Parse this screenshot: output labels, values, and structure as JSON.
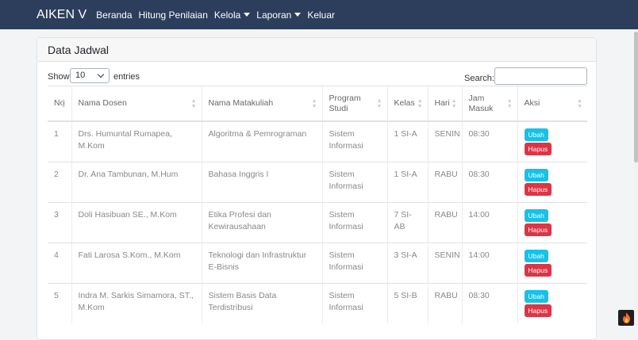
{
  "navbar": {
    "brand": "AIKEN V",
    "items": [
      {
        "label": "Beranda"
      },
      {
        "label": "Hitung Penilaian"
      },
      {
        "label": "Kelola"
      },
      {
        "label": "Laporan"
      },
      {
        "label": "Keluar"
      }
    ]
  },
  "card": {
    "title": "Data Jadwal"
  },
  "table_controls": {
    "show_label": "Show",
    "entries_value": "10",
    "entries_label": "entries",
    "search_label": "Search:",
    "search_value": ""
  },
  "table": {
    "headers": [
      "No",
      "Nama Dosen",
      "Nama Matakuliah",
      "Program Studi",
      "Kelas",
      "Hari",
      "Jam Masuk",
      "Aksi"
    ],
    "rows": [
      {
        "no": "1",
        "dosen": "Drs. Humuntal Rumapea, M.Kom",
        "matakuliah": "Algoritma & Pemrograman",
        "prodi": "Sistem Informasi",
        "kelas": "1 SI-A",
        "hari": "SENIN",
        "jam": "08:30"
      },
      {
        "no": "2",
        "dosen": "Dr. Ana Tambunan, M.Hum",
        "matakuliah": "Bahasa Inggris I",
        "prodi": "Sistem Informasi",
        "kelas": "1 SI-A",
        "hari": "RABU",
        "jam": "08:30"
      },
      {
        "no": "3",
        "dosen": "Doli Hasibuan SE., M.Kom",
        "matakuliah": "Etika Profesi dan Kewirausahaan",
        "prodi": "Sistem Informasi",
        "kelas": "7 SI-AB",
        "hari": "RABU",
        "jam": "14:00"
      },
      {
        "no": "4",
        "dosen": "Fati Larosa S.Kom., M.Kom",
        "matakuliah": "Teknologi dan Infrastruktur E-Bisnis",
        "prodi": "Sistem Informasi",
        "kelas": "3 SI-A",
        "hari": "SENIN",
        "jam": "14:00"
      },
      {
        "no": "5",
        "dosen": "Indra M. Sarkis Simamora, ST., M.Kom",
        "matakuliah": "Sistem Basis Data Terdistribusi",
        "prodi": "Sistem Informasi",
        "kelas": "5 SI-B",
        "hari": "RABU",
        "jam": "08:30"
      }
    ],
    "action_edit": "Ubah",
    "action_delete": "Hapus"
  },
  "colors": {
    "navbar": "#2c3e5b",
    "edit_button": "#17c1e8",
    "delete_button": "#dc3545"
  },
  "icons": {
    "sort": "sort-arrows-icon",
    "dropdown": "caret-down-icon",
    "corner": "flame-icon"
  }
}
